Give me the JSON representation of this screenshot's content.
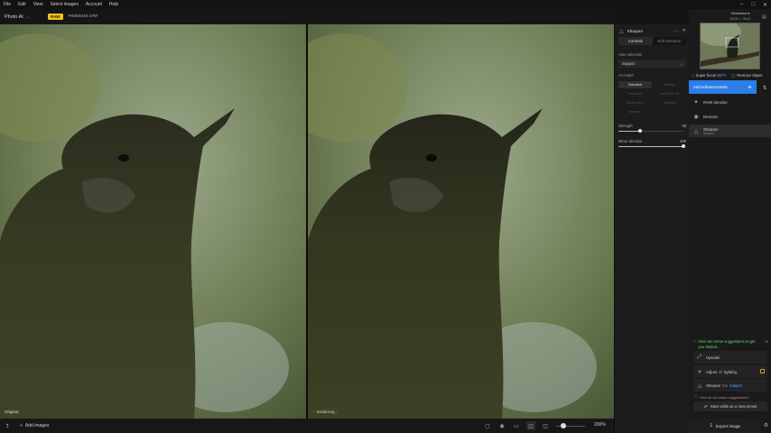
{
  "menubar": {
    "items": [
      "File",
      "Edit",
      "View",
      "Select images",
      "Account",
      "Help"
    ]
  },
  "toolbar": {
    "app_name": "Photo AI",
    "raw_badge": "RAW",
    "filename": "P8060346.ORF"
  },
  "viewer": {
    "left_label": "Original",
    "right_label": "Initializing..."
  },
  "statusbar": {
    "add_images": "Add images",
    "zoom": "200%"
  },
  "tool_panel": {
    "title": "Sharpen",
    "tabs": [
      "Controls",
      "Edit selection"
    ],
    "auto_selection_label": "Auto selection",
    "auto_selection_value": "Subject",
    "ai_model_label": "AI model",
    "modes": [
      "Standard",
      "Strong",
      "Lens blur",
      "Lens blur V2",
      "Motion blur",
      "Natural",
      "Refocus"
    ],
    "active_mode": "Standard",
    "strength_label": "Strength",
    "strength_value": "33",
    "strength_fraction": 0.33,
    "minor_denoise_label": "Minor denoise",
    "minor_denoise_value": "100",
    "minor_denoise_fraction": 1.0
  },
  "right_panel": {
    "dimensions_label": "Dimensions",
    "dimensions_value": "5240 × 3912",
    "super_focus_label": "Super focus",
    "super_focus_beta": "BETA",
    "remove_object_label": "Remove object",
    "add_enhancements": "Add enhancements",
    "enhancements": [
      {
        "label": "RAW denoise",
        "sub": ""
      },
      {
        "label": "Denoise",
        "sub": ""
      },
      {
        "label": "Sharpen",
        "sub": "Subject"
      }
    ],
    "suggestions_header": "Here are some suggestions to get you started...",
    "suggestions": [
      {
        "label": "Upscale",
        "muted": "",
        "link": ""
      },
      {
        "label": "Adjust",
        "muted": "all",
        "link": "lighting"
      },
      {
        "label": "Sharpen",
        "muted": "the",
        "link": "subject"
      }
    ],
    "how_suggestions": "How do we make suggestions?",
    "save_preset": "Save edits as a new preset",
    "export": "Export image"
  }
}
